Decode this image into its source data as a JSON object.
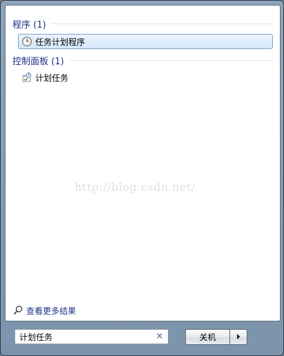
{
  "programs_section": {
    "title": "程序 (1)",
    "items": [
      {
        "label": "任务计划程序",
        "icon": "clock-icon",
        "selected": true
      }
    ]
  },
  "control_panel_section": {
    "title": "控制面板 (1)",
    "items": [
      {
        "label": "计划任务",
        "icon": "scheduled-tasks-icon",
        "selected": false
      }
    ]
  },
  "watermark": "http://blog.csdn.net/",
  "see_more": {
    "label": "查看更多结果",
    "icon": "search-icon"
  },
  "search": {
    "value": "计划任务",
    "clear_symbol": "×"
  },
  "shutdown": {
    "label": "关机",
    "arrow_icon": "triangle-right-icon"
  },
  "colors": {
    "header_text": "#1e3287",
    "selection_border": "#7da2ce",
    "frame": "#7b93ab"
  }
}
